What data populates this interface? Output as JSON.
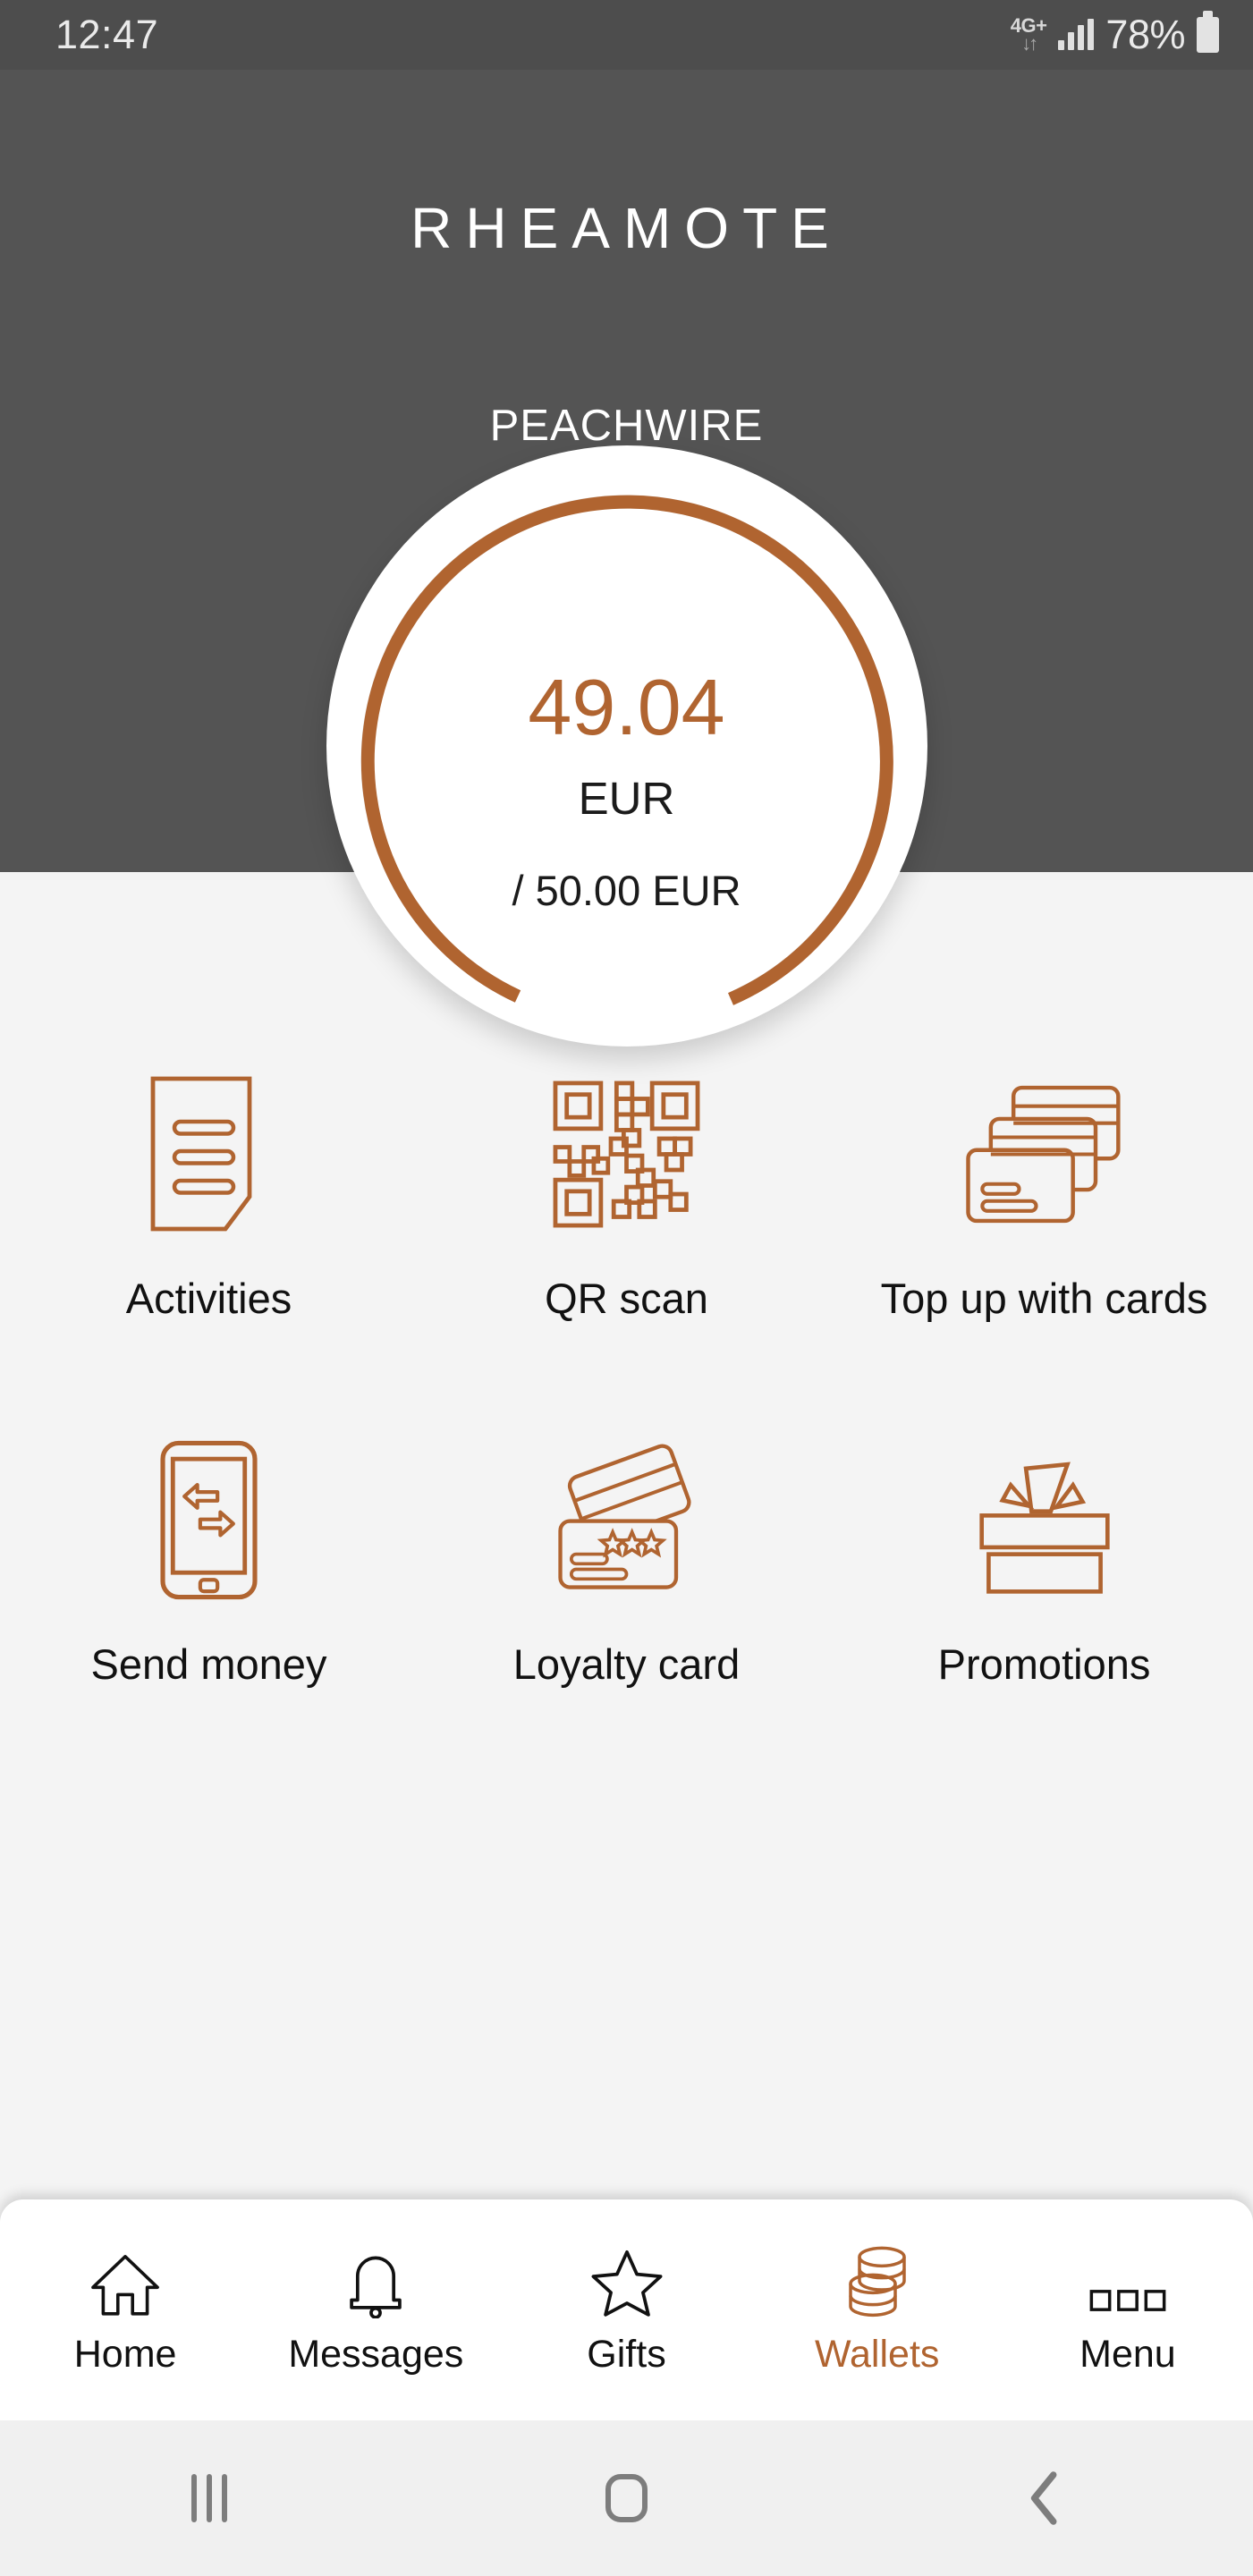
{
  "status_bar": {
    "time": "12:47",
    "network_label": "4G+",
    "network_arrows": "↓↑",
    "battery_percent": "78%",
    "signal_icon": "signal-bars-icon",
    "battery_icon": "battery-icon"
  },
  "header": {
    "app_title": "RHEAMOTE",
    "wallet_name": "PEACHWIRE"
  },
  "balance": {
    "amount": "49.04",
    "currency": "EUR",
    "limit": "/ 50.00 EUR"
  },
  "actions": [
    {
      "label": "Activities",
      "icon": "document-lines-icon"
    },
    {
      "label": "QR scan",
      "icon": "qr-code-icon"
    },
    {
      "label": "Top up with cards",
      "icon": "stacked-cards-icon"
    },
    {
      "label": "Send money",
      "icon": "phone-transfer-icon"
    },
    {
      "label": "Loyalty card",
      "icon": "loyalty-card-icon"
    },
    {
      "label": "Promotions",
      "icon": "gift-box-icon"
    }
  ],
  "tabs": [
    {
      "label": "Home",
      "icon": "house-icon",
      "active": false
    },
    {
      "label": "Messages",
      "icon": "bell-icon",
      "active": false
    },
    {
      "label": "Gifts",
      "icon": "star-icon",
      "active": false
    },
    {
      "label": "Wallets",
      "icon": "coin-stack-icon",
      "active": true
    },
    {
      "label": "Menu",
      "icon": "three-squares-icon",
      "active": false
    }
  ],
  "system_nav": {
    "recents": "recents-icon",
    "home": "home-icon",
    "back": "back-icon"
  },
  "colors": {
    "accent": "#b06430",
    "header_bg": "#545454",
    "body_bg": "#f4f4f4",
    "status_bg": "#4d4d4d"
  },
  "chart_data": {
    "type": "gauge",
    "value": 49.04,
    "max": 50.0,
    "unit": "EUR",
    "percent": 98.1,
    "title": "PEACHWIRE balance"
  }
}
